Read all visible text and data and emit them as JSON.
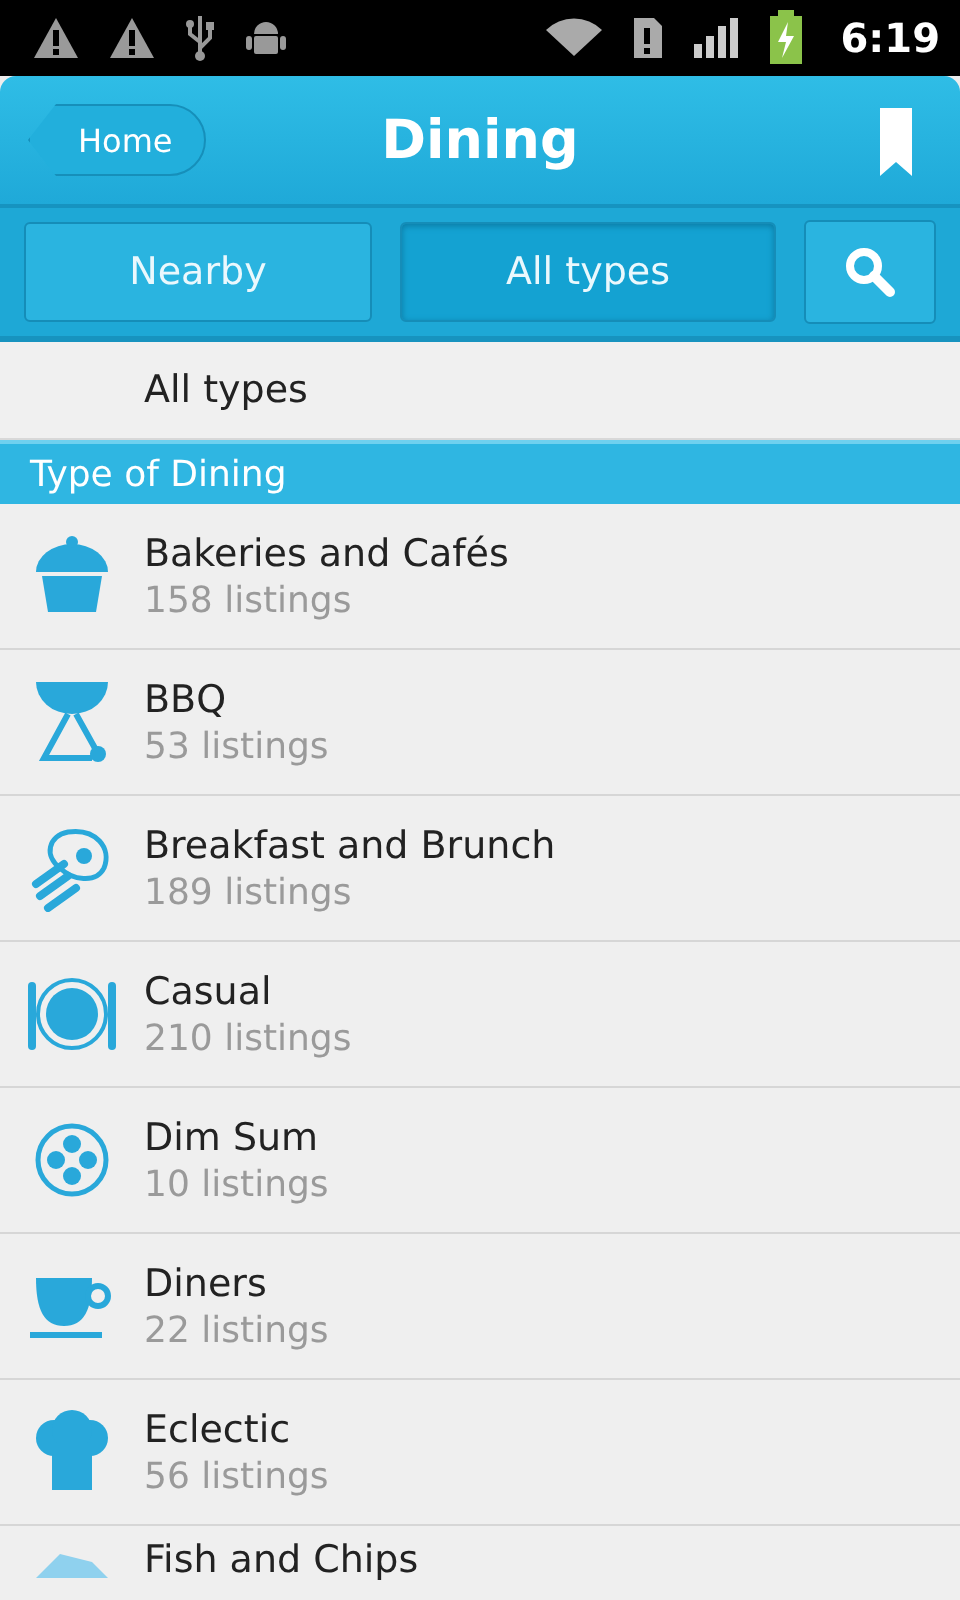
{
  "status_bar": {
    "time": "6:19"
  },
  "header": {
    "back": "Home",
    "title": "Dining"
  },
  "tabs": [
    {
      "label": "Nearby",
      "selected": false
    },
    {
      "label": "All types",
      "selected": true
    }
  ],
  "filter": {
    "value": "All types"
  },
  "section": {
    "title": "Type of Dining"
  },
  "items": [
    {
      "name": "Bakeries and Cafés",
      "count": "158 listings"
    },
    {
      "name": "BBQ",
      "count": "53 listings"
    },
    {
      "name": "Breakfast and Brunch",
      "count": "189 listings"
    },
    {
      "name": "Casual",
      "count": "210 listings"
    },
    {
      "name": "Dim Sum",
      "count": "10 listings"
    },
    {
      "name": "Diners",
      "count": "22 listings"
    },
    {
      "name": "Eclectic",
      "count": "56 listings"
    },
    {
      "name": "Fish and Chips"
    }
  ]
}
